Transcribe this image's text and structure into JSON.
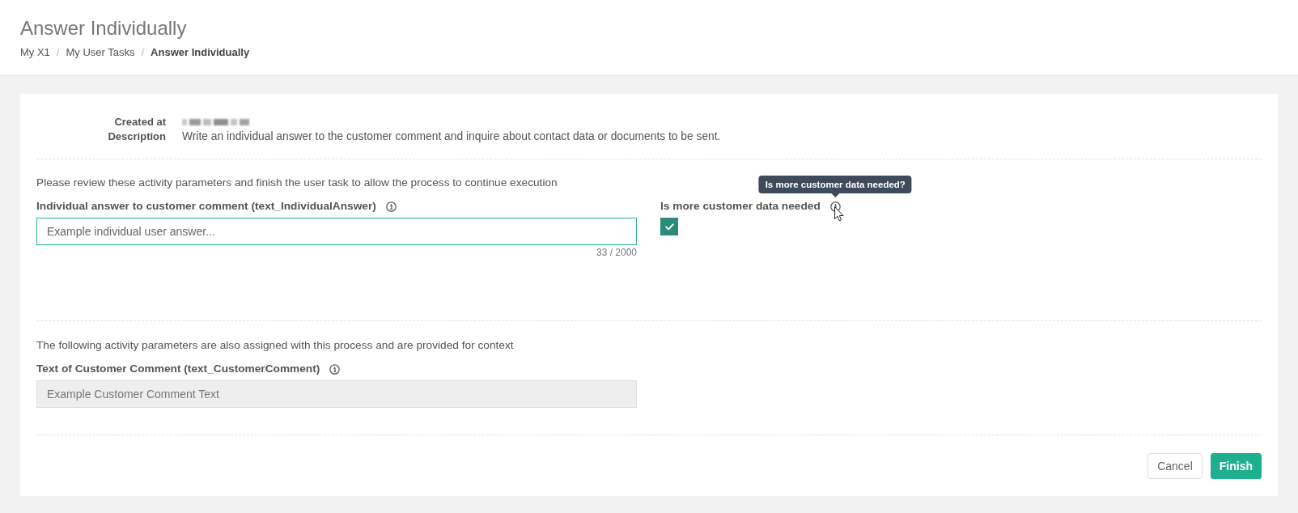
{
  "page_header": {
    "title": "Answer Individually",
    "breadcrumb": [
      {
        "label": "My X1",
        "current": false
      },
      {
        "label": "My User Tasks",
        "current": false,
        "separator": "/"
      },
      {
        "label": "Answer Individually",
        "current": true,
        "separator": "/"
      }
    ]
  },
  "details": [
    {
      "label": "Created at",
      "kind": "blurred"
    },
    {
      "label": "Description",
      "kind": "text",
      "value": "Write an individual answer to the customer comment and inquire about contact data or documents to be sent."
    }
  ],
  "task_parameters": {
    "intro": "Please review these activity parameters and finish the user task to allow the process to continue execution",
    "fields": [
      {
        "kind": "text_input",
        "label": "Individual answer to customer comment (text_IndividualAnswer)",
        "value": "Example individual user answer...",
        "counter": "33 / 2000",
        "focused": true,
        "disabled": false
      },
      {
        "kind": "checkbox",
        "label": "Is more customer data needed",
        "checked": true,
        "tooltip": "Is more customer data needed?"
      }
    ]
  },
  "context_parameters": {
    "intro": "The following activity parameters are also assigned with this process and are provided for context",
    "fields": [
      {
        "kind": "text_input",
        "label": "Text of Customer Comment (text_CustomerComment)",
        "value": "Example Customer Comment Text",
        "focused": false,
        "disabled": true
      }
    ]
  },
  "buttons": [
    {
      "label": "Cancel",
      "kind": "secondary"
    },
    {
      "label": "Finish",
      "kind": "primary"
    }
  ]
}
